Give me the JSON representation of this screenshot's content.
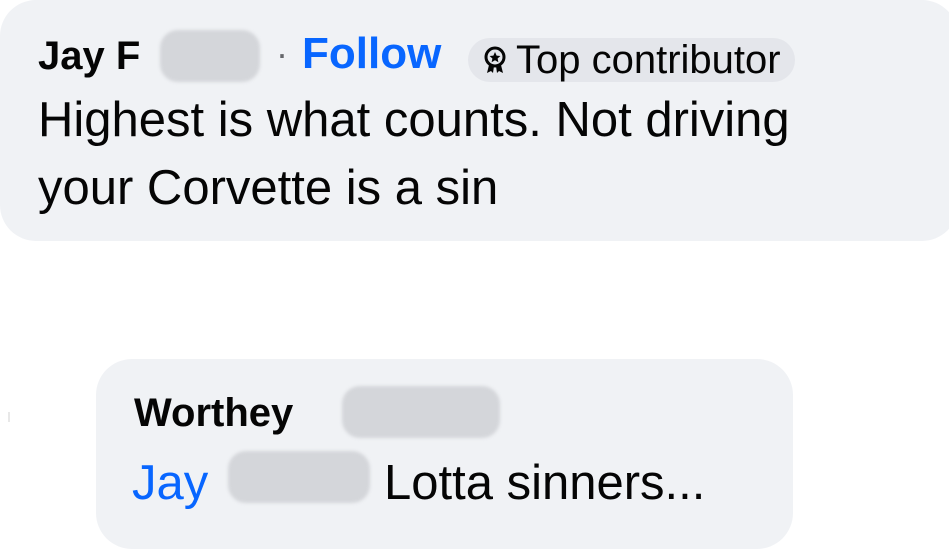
{
  "comments": [
    {
      "author": "Jay F",
      "separator": "·",
      "follow_label": "Follow",
      "badge_icon": "top-contributor-badge-icon",
      "badge_label": "Top contributor",
      "text_line1": "Highest is what counts. Not driving",
      "text_line2": "your Corvette is a sin"
    },
    {
      "author": "Worthey",
      "mention": "Jay",
      "text": "Lotta sinners..."
    }
  ],
  "colors": {
    "bubble": "#f0f2f5",
    "link": "#0866ff",
    "badge_bg": "#e4e6eb",
    "redaction": "#d4d6da"
  }
}
